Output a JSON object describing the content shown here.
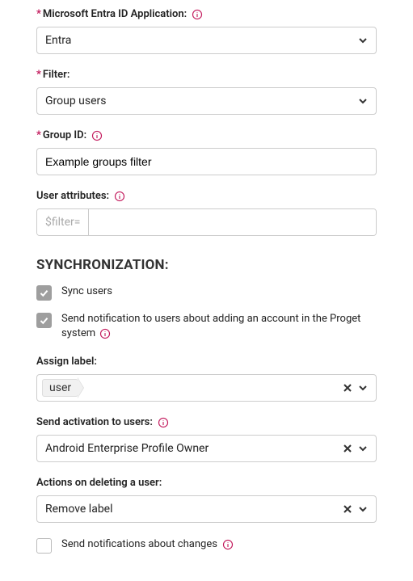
{
  "entra_app": {
    "label": "Microsoft Entra ID Application:",
    "value": "Entra"
  },
  "filter": {
    "label": "Filter:",
    "value": "Group users"
  },
  "group_id": {
    "label": "Group ID:",
    "value": "Example groups filter"
  },
  "user_attributes": {
    "label": "User attributes:",
    "prefix": "$filter=",
    "value": ""
  },
  "sync_heading": "SYNCHRONIZATION:",
  "sync_users": {
    "label": "Sync users",
    "checked": true
  },
  "send_notification_add": {
    "label": "Send notification to users about adding an account in the Proget system",
    "checked": true
  },
  "assign_label": {
    "label": "Assign label:",
    "tag": "user"
  },
  "send_activation": {
    "label": "Send activation to users:",
    "value": "Android Enterprise Profile Owner"
  },
  "actions_delete": {
    "label": "Actions on deleting a user:",
    "value": "Remove label"
  },
  "send_notifications_changes": {
    "label": "Send notifications about changes",
    "checked": false
  }
}
